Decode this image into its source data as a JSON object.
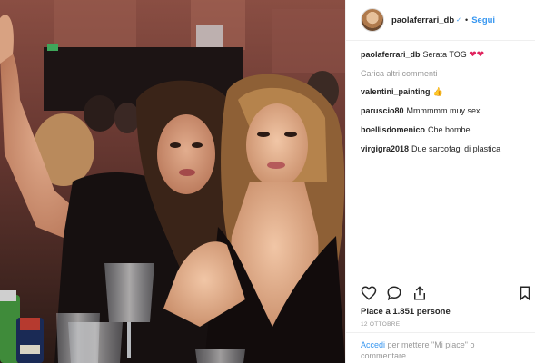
{
  "header": {
    "username": "paolaferrari_db",
    "verified_glyph": "✓",
    "separator": "•",
    "follow_label": "Segui"
  },
  "caption": {
    "username": "paolaferrari_db",
    "text": "Serata TOG",
    "emoji": "❤❤"
  },
  "load_more": "Carica altri commenti",
  "comments": [
    {
      "user": "valentini_painting",
      "text": "👍"
    },
    {
      "user": "paruscio80",
      "text": "Mmmmmm muy sexi"
    },
    {
      "user": "boellisdomenico",
      "text": "Che bombe"
    },
    {
      "user": "virgigra2018",
      "text": "Due sarcofagi di plastica"
    }
  ],
  "likes_text": "Piace a 1.851 persone",
  "date_text": "12 OTTOBRE",
  "login_prompt": {
    "link": "Accedi",
    "rest": " per mettere \"Mi piace\" o commentare."
  },
  "icons": [
    "heart-icon",
    "comment-icon",
    "share-icon",
    "bookmark-icon"
  ],
  "colors": {
    "accent": "#3897f0",
    "text": "#262626",
    "muted": "#999999",
    "heart": "#e0245e"
  }
}
